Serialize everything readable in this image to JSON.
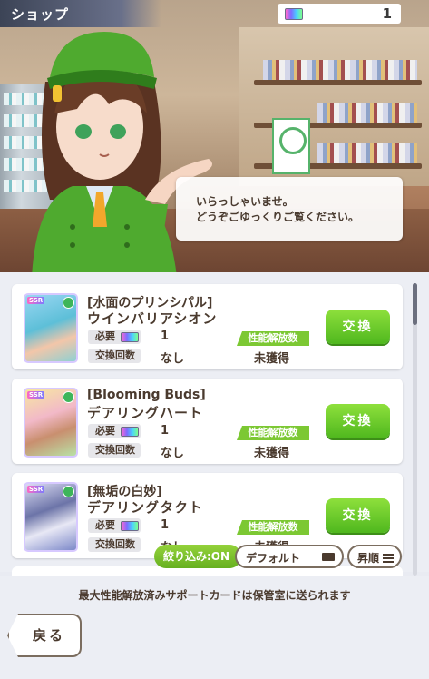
{
  "header": {
    "title": "ショップ"
  },
  "currency": {
    "icon": "ticket-icon",
    "value": "1"
  },
  "dialogue": {
    "text": "いらっしゃいませ。\nどうぞごゆっくりご覧ください。"
  },
  "labels": {
    "cost": "必要",
    "count": "交換回数",
    "unlock": "性能解放数",
    "exchange": "交換"
  },
  "items": [
    {
      "bracket": "[水面のプリンシパル]",
      "name": "ウインバリアシオン",
      "cost": "1",
      "count": "なし",
      "status": "未獲得",
      "rarity": "SSR"
    },
    {
      "bracket": "[Blooming Buds]",
      "name": "デアリングハート",
      "cost": "1",
      "count": "なし",
      "status": "未獲得",
      "rarity": "SSR"
    },
    {
      "bracket": "[無垢の白妙]",
      "name": "デアリングタクト",
      "cost": "1",
      "count": "なし",
      "status": "未獲得",
      "rarity": "SSR"
    }
  ],
  "filters": {
    "filter_on": "絞り込み:ON",
    "default": "デフォルト",
    "sort": "昇順"
  },
  "footer": {
    "notice": "最大性能解放済みサポートカードは保管室に送られます",
    "back": "戻る"
  },
  "colors": {
    "exchange_button": "#5cc428",
    "tag": "#7cc833",
    "text": "#4a3a2e"
  }
}
